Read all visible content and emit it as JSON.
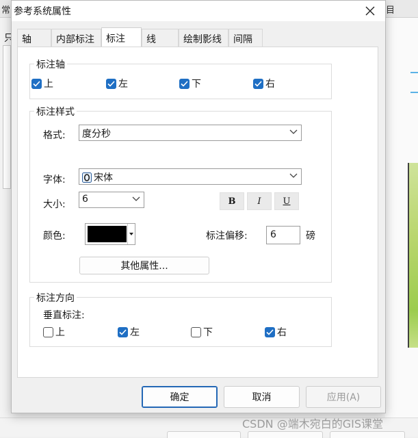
{
  "background": {
    "topbar_fragments": [
      "常",
      "目"
    ],
    "left_fragment": "只",
    "watermark": "CSDN @端木宛白的GIS课堂"
  },
  "dialog": {
    "title": "参考系统属性",
    "tabs": [
      "轴",
      "内部标注",
      "标注",
      "线",
      "绘制影线",
      "间隔"
    ],
    "active_tab": "标注"
  },
  "label_axes": {
    "legend": "标注轴",
    "options": [
      {
        "label": "上",
        "checked": true
      },
      {
        "label": "左",
        "checked": true
      },
      {
        "label": "下",
        "checked": true
      },
      {
        "label": "右",
        "checked": true
      }
    ]
  },
  "label_style": {
    "legend": "标注样式",
    "format_label": "格式:",
    "format_value": "度分秒",
    "font_label": "字体:",
    "font_value": "宋体",
    "font_icon": "opentype-font-icon",
    "size_label": "大小:",
    "size_value": "6",
    "bold": "B",
    "italic": "I",
    "underline": "U",
    "color_label": "颜色:",
    "color_value": "#000000",
    "offset_label": "标注偏移:",
    "offset_value": "6",
    "offset_unit": "磅",
    "more_props": "其他属性..."
  },
  "label_direction": {
    "legend": "标注方向",
    "vertical_label": "垂直标注:",
    "options": [
      {
        "label": "上",
        "checked": false
      },
      {
        "label": "左",
        "checked": true
      },
      {
        "label": "下",
        "checked": false
      },
      {
        "label": "右",
        "checked": true
      }
    ]
  },
  "footer": {
    "ok": "确定",
    "cancel": "取消",
    "apply": "应用(A)"
  }
}
